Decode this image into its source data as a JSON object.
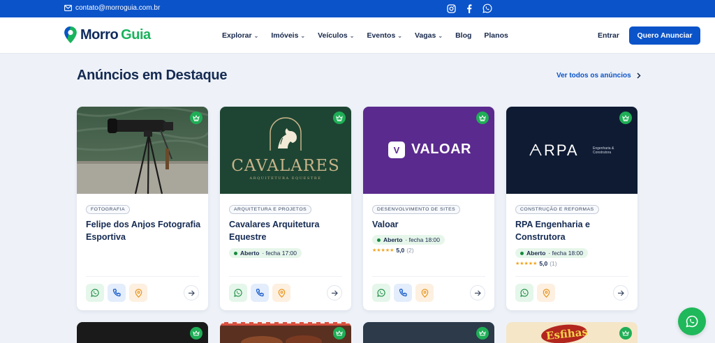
{
  "topbar": {
    "email": "contato@morroguia.com.br",
    "icons": [
      "mail-icon",
      "instagram-icon",
      "facebook-icon",
      "whatsapp-icon"
    ]
  },
  "nav": {
    "logo": {
      "part1": "Morro",
      "part2": "Guia"
    },
    "menu": [
      {
        "label": "Explorar",
        "dropdown": true
      },
      {
        "label": "Imóveis",
        "dropdown": true
      },
      {
        "label": "Veículos",
        "dropdown": true
      },
      {
        "label": "Eventos",
        "dropdown": true
      },
      {
        "label": "Vagas",
        "dropdown": true
      },
      {
        "label": "Blog",
        "dropdown": false
      },
      {
        "label": "Planos",
        "dropdown": false
      }
    ],
    "login": "Entrar",
    "cta": "Quero Anunciar"
  },
  "section": {
    "title": "Anúncios em Destaque",
    "see_all": "Ver todos os anúncios"
  },
  "cards": [
    {
      "category": "FOTOGRAFIA",
      "name": "Felipe dos Anjos Fotografia Esportiva",
      "status": "",
      "hours": "",
      "rating": "",
      "reviews": "",
      "actions": [
        "whatsapp",
        "phone",
        "map"
      ]
    },
    {
      "category": "ARQUITETURA E PROJETOS",
      "name": "Cavalares Arquitetura Equestre",
      "status": "Aberto",
      "hours": "· fecha 17:00",
      "rating": "",
      "reviews": "",
      "actions": [
        "whatsapp",
        "phone",
        "map"
      ],
      "logo_text": "CAVALARES",
      "logo_sub": "ARQUITETURA EQUESTRE"
    },
    {
      "category": "DESENVOLVIMENTO DE SITES",
      "name": "Valoar",
      "status": "Aberto",
      "hours": "· fecha 18:00",
      "rating": "5,0",
      "reviews": "(2)",
      "actions": [
        "whatsapp",
        "phone",
        "map"
      ],
      "logo_text": "VALOAR",
      "logo_badge": "V"
    },
    {
      "category": "CONSTRUÇÃO E REFORMAS",
      "name": "RPA Engenharia e Construtora",
      "status": "Aberto",
      "hours": "· fecha 18:00",
      "rating": "5,0",
      "reviews": "(1)",
      "actions": [
        "whatsapp",
        "map"
      ],
      "logo_text": "RPA",
      "logo_sub1": "Engenharia &",
      "logo_sub2": "Construtora"
    }
  ],
  "lower_cards": {
    "logo_text": "Esfihas"
  },
  "colors": {
    "primary": "#0b53c9",
    "green": "#1fae56",
    "navy": "#142a52"
  }
}
